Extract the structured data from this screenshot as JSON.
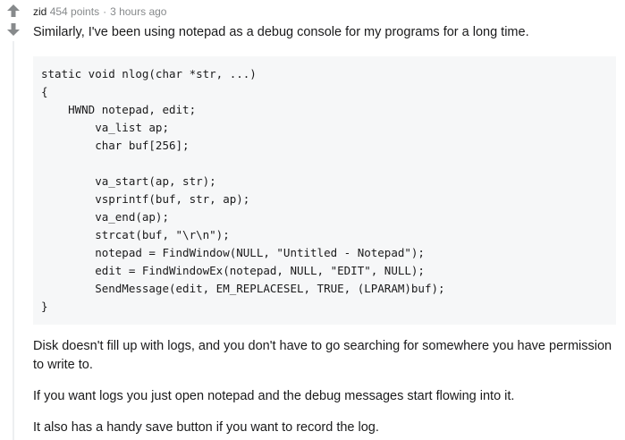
{
  "comment": {
    "author": "zid",
    "points": "454 points",
    "separator": "·",
    "time": "3 hours ago",
    "intro": "Similarly, I've been using notepad as a debug console for my programs for a long time.",
    "code_lines": [
      "static void nlog(char *str, ...)",
      "{",
      "    HWND notepad, edit;",
      "        va_list ap;",
      "        char buf[256];",
      "",
      "        va_start(ap, str);",
      "        vsprintf(buf, str, ap);",
      "        va_end(ap);",
      "        strcat(buf, \"\\r\\n\");",
      "        notepad = FindWindow(NULL, \"Untitled - Notepad\");",
      "        edit = FindWindowEx(notepad, NULL, \"EDIT\", NULL);",
      "        SendMessage(edit, EM_REPLACESEL, TRUE, (LPARAM)buf);",
      "}"
    ],
    "paragraphs": [
      "Disk doesn't fill up with logs, and you don't have to go searching for somewhere you have permission to write to.",
      "If you want logs you just open notepad and the debug messages start flowing into it.",
      "It also has a handy save button if you want to record the log."
    ]
  },
  "icons": {
    "upvote": "upvote-arrow-icon",
    "downvote": "downvote-arrow-icon"
  },
  "colors": {
    "arrow": "#878a8c",
    "meta_text": "#878a8c",
    "code_background": "#f6f7f8",
    "thread_line": "#edeff1"
  }
}
